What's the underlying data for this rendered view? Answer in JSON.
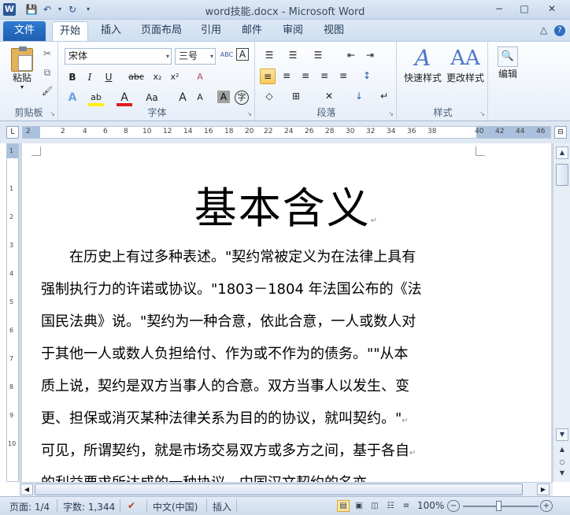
{
  "window": {
    "title": "word技能.docx - Microsoft Word",
    "app_icon": "W",
    "minimize": "−",
    "maximize": "□",
    "close": "✕"
  },
  "qat": {
    "save": "💾",
    "undo": "↶",
    "undo_arrow": "▾",
    "redo": "↻",
    "customize": "▾"
  },
  "tabs": {
    "file": "文件",
    "items": [
      "开始",
      "插入",
      "页面布局",
      "引用",
      "邮件",
      "审阅",
      "视图"
    ],
    "active_index": 0,
    "collapse": "△",
    "help": "?"
  },
  "ribbon": {
    "clipboard": {
      "label": "剪贴板",
      "paste": "粘贴",
      "paste_arrow": "▾",
      "cut": "✂",
      "copy": "⧉",
      "format_painter": "🖌"
    },
    "font": {
      "label": "字体",
      "font_name": "宋体",
      "font_size": "三号",
      "combo_arrow": "▾",
      "phonetic": "ABC",
      "char_border": "A",
      "bold": "B",
      "italic": "I",
      "underline": "U",
      "strikethrough": "abc",
      "subscript": "x₂",
      "superscript": "x²",
      "clear_format": "A",
      "text_effects": "A",
      "highlight": "ab",
      "font_color": "A",
      "change_case": "Aa",
      "grow": "A",
      "shrink": "A",
      "char_shading": "A",
      "enclose": "字"
    },
    "paragraph": {
      "label": "段落",
      "bullets": "☰",
      "numbering": "☰",
      "multilevel": "☰",
      "decrease_indent": "⇤",
      "increase_indent": "⇥",
      "align_left": "≡",
      "center": "≡",
      "align_right": "≡",
      "justify": "≡",
      "distributed": "≡",
      "line_spacing": "↕",
      "shading": "◇",
      "borders": "⊞",
      "chinese_layout": "✕",
      "sort": "↓",
      "show_marks": "↵"
    },
    "styles": {
      "label": "样式",
      "quick_styles": "快速样式",
      "change_styles": "更改样式"
    },
    "editing": {
      "label": "编辑",
      "find_icon": "🔍"
    },
    "launcher": "↘"
  },
  "ruler": {
    "corner": "L",
    "numbers": [
      "2",
      "2",
      "4",
      "6",
      "8",
      "10",
      "12",
      "14",
      "16",
      "18",
      "20",
      "22",
      "24",
      "26",
      "28",
      "30",
      "32",
      "34",
      "36",
      "38",
      "40",
      "42",
      "44",
      "46"
    ],
    "vnumbers": [
      "1",
      "1",
      "2",
      "3",
      "4",
      "5",
      "6",
      "7",
      "8",
      "9",
      "10"
    ]
  },
  "document": {
    "title": "基本含义",
    "lines": [
      "　　在历史上有过多种表述。\"契约常被定义为在法律上具有",
      "强制执行力的许诺或协议。\"1803－1804 年法国公布的《法",
      "国民法典》说。\"契约为一种合意，依此合意，一人或数人对",
      "于其他一人或数人负担给付、作为或不作为的债务。\"\"从本",
      "质上说，契约是双方当事人的合意。双方当事人以发生、变",
      "更、担保或消灭某种法律关系为目的的协议，就叫契约。\"",
      "可见，所谓契约，就是市场交易双方或多方之间，基于各自",
      "的利益要求所达成的一种协议。中国汉文契约的名亦"
    ],
    "para_mark": "↵"
  },
  "statusbar": {
    "page": "页面: 1/4",
    "words": "字数: 1,344",
    "language": "中文(中国)",
    "mode": "插入",
    "zoom": "100%",
    "zoom_out": "−",
    "zoom_in": "+",
    "proof_icon": "✔"
  },
  "scroll": {
    "up": "▲",
    "down": "▼",
    "left": "◀",
    "right": "▶",
    "prev": "▲",
    "browse": "○",
    "next": "▼"
  }
}
